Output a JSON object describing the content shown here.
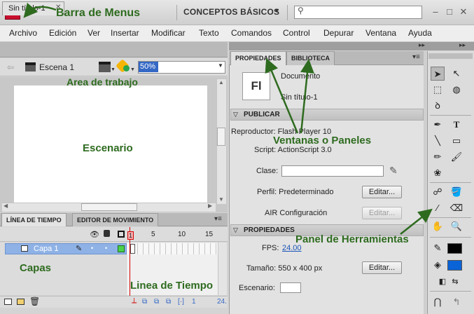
{
  "app": {
    "logo_text": "Fl",
    "workspace": "CONCEPTOS BÁSICOS",
    "workspace_arrow": "▼",
    "search_placeholder": "",
    "window_controls": [
      "–",
      "□",
      "✕"
    ]
  },
  "menubar": [
    "Archivo",
    "Edición",
    "Ver",
    "Insertar",
    "Modificar",
    "Texto",
    "Comandos",
    "Control",
    "Depurar",
    "Ventana",
    "Ayuda"
  ],
  "document": {
    "tab_label": "Sin título-1",
    "tab_close": "✕",
    "scene": "Escena 1",
    "zoom": "50%"
  },
  "timeline": {
    "tabs": [
      "LÍNEA DE TIEMPO",
      "EDITOR DE MOVIMIENTO"
    ],
    "frame_numbers": [
      "1",
      "5",
      "10",
      "15"
    ],
    "layer_name": "Capa 1",
    "frame_rate": "24."
  },
  "properties": {
    "tabs": [
      "PROPIEDADES",
      "BIBLIOTECA"
    ],
    "doc_icon": "Fl",
    "doc_type": "Documento",
    "doc_name": "Sin título-1",
    "publish_header": "PUBLICAR",
    "player": "Reproductor: Flash Player 10",
    "script": "Script: ActionScript 3.0",
    "class_label": "Clase:",
    "profile": "Perfil: Predeterminado",
    "air": "AIR Configuración",
    "edit_label": "Editar...",
    "props_header": "PROPIEDADES",
    "fps_label": "FPS:",
    "fps_value": "24.00",
    "size": "Tamaño: 550 x 400 px",
    "stage_label": "Escenario:"
  },
  "tools": {
    "stroke_color": "#000000",
    "fill_color": "#0a64d8"
  },
  "annotations": {
    "menus": "Barra de Menus",
    "work_area": "Area de trabajo",
    "stage": "Escenario",
    "panels": "Ventanas o Paneles",
    "tools": "Panel de Herramientas",
    "layers": "Capas",
    "timeline": "Linea de Tiempo"
  }
}
